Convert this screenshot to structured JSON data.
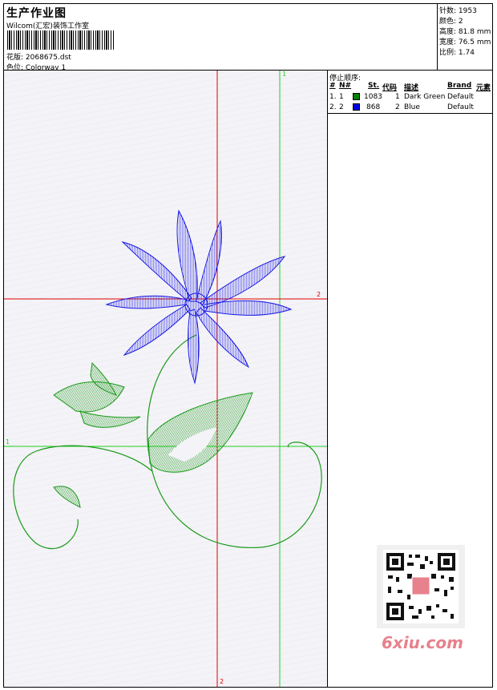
{
  "header": {
    "title": "生产作业图",
    "studio": "Wilcom(汇宏)装饰工作室",
    "design_label": "花版:",
    "design_value": "2068675.dst",
    "color_label": "色位:",
    "color_value": "Colorway 1"
  },
  "stats": [
    {
      "label": "针数:",
      "value": "1953"
    },
    {
      "label": "颜色:",
      "value": "2"
    },
    {
      "label": "高度:",
      "value": "81.8 mm"
    },
    {
      "label": "宽度:",
      "value": "76.5 mm"
    },
    {
      "label": "比例:",
      "value": "1.74"
    }
  ],
  "stop_sequence": {
    "label": "停止顺序:",
    "columns": [
      "#",
      "N#",
      "St.",
      "代码",
      "描述",
      "Brand",
      "元素"
    ],
    "rows": [
      {
        "idx": "1.",
        "n": "1",
        "color": "#008000",
        "st": "1083",
        "code": "1",
        "desc": "Dark Green",
        "brand": "Default"
      },
      {
        "idx": "2.",
        "n": "2",
        "color": "#0000e0",
        "st": "868",
        "code": "2",
        "desc": "Blue",
        "brand": "Default"
      }
    ]
  },
  "guides": {
    "v_green": "1",
    "h_red": "2",
    "h_green": "1",
    "v_red": "2"
  },
  "colors": {
    "green": "#1a9a1a",
    "blue": "#1a1ae6",
    "red": "#e00000",
    "guide_green": "#20d020"
  },
  "watermark": "6xiu.com",
  "qr_icon": "qr-code-icon"
}
